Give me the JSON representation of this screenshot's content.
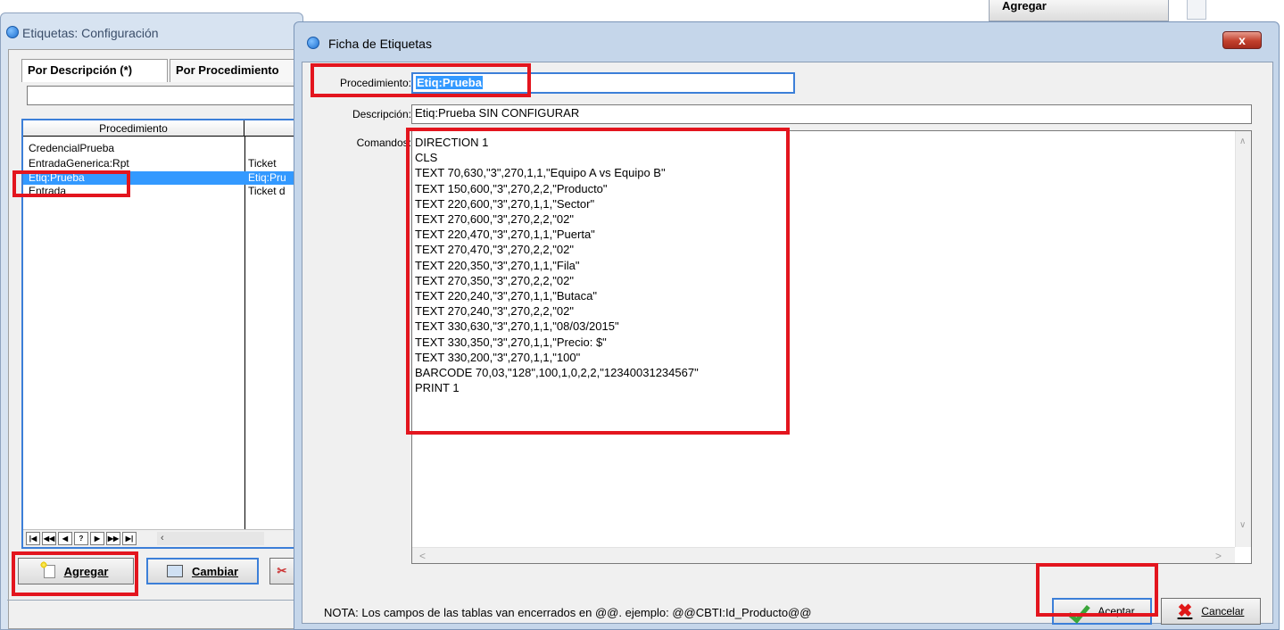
{
  "background_window": {
    "button_label": "Agregar"
  },
  "left_window": {
    "title": "Etiquetas: Configuración",
    "tabs": [
      "Por Descripción (*)",
      "Por Procedimiento"
    ],
    "filter_value": "",
    "grid": {
      "columns": [
        "Procedimiento",
        ""
      ],
      "rows": [
        {
          "proc": "CredencialPrueba",
          "desc": ""
        },
        {
          "proc": "EntradaGenerica:Rpt",
          "desc": "Ticket"
        },
        {
          "proc": "Etiq:Prueba",
          "desc": "Etiq:Pru",
          "selected": true
        },
        {
          "proc": "Entrada",
          "desc": "Ticket d"
        }
      ]
    },
    "nav_buttons": [
      "|◀",
      "◀◀",
      "◀",
      "?",
      "▶",
      "▶▶",
      "▶|"
    ],
    "buttons": {
      "add": "Agregar",
      "change": "Cambiar"
    }
  },
  "dialog": {
    "title": "Ficha de Etiquetas",
    "close_label": "x",
    "procedimiento_label": "Procedimiento:",
    "procedimiento_value": "Etiq:Prueba",
    "descripcion_label": "Descripción:",
    "descripcion_value": "Etiq:Prueba SIN CONFIGURAR",
    "comandos_label": "Comandos:",
    "comandos": [
      "DIRECTION 1",
      "CLS",
      "TEXT 70,630,\"3\",270,1,1,\"Equipo A vs Equipo B\"",
      "TEXT 150,600,\"3\",270,2,2,\"Producto\"",
      "TEXT 220,600,\"3\",270,1,1,\"Sector\"",
      "TEXT 270,600,\"3\",270,2,2,\"02\"",
      "TEXT 220,470,\"3\",270,1,1,\"Puerta\"",
      "TEXT 270,470,\"3\",270,2,2,\"02\"",
      "TEXT 220,350,\"3\",270,1,1,\"Fila\"",
      "TEXT 270,350,\"3\",270,2,2,\"02\"",
      "TEXT 220,240,\"3\",270,1,1,\"Butaca\"",
      "TEXT 270,240,\"3\",270,2,2,\"02\"",
      "TEXT 330,630,\"3\",270,1,1,\"08/03/2015\"",
      "TEXT 330,350,\"3\",270,1,1,\"Precio: $\"",
      "TEXT 330,200,\"3\",270,1,1,\"100\"",
      "BARCODE 70,03,\"128\",100,1,0,2,2,\"12340031234567\"",
      "PRINT 1"
    ],
    "nota": "NOTA: Los campos de las tablas van encerrados en @@. ejemplo:  @@CBTI:Id_Producto@@",
    "accept_label": "Aceptar",
    "cancel_label": "Cancelar"
  },
  "annotation_color": "#e3151e"
}
